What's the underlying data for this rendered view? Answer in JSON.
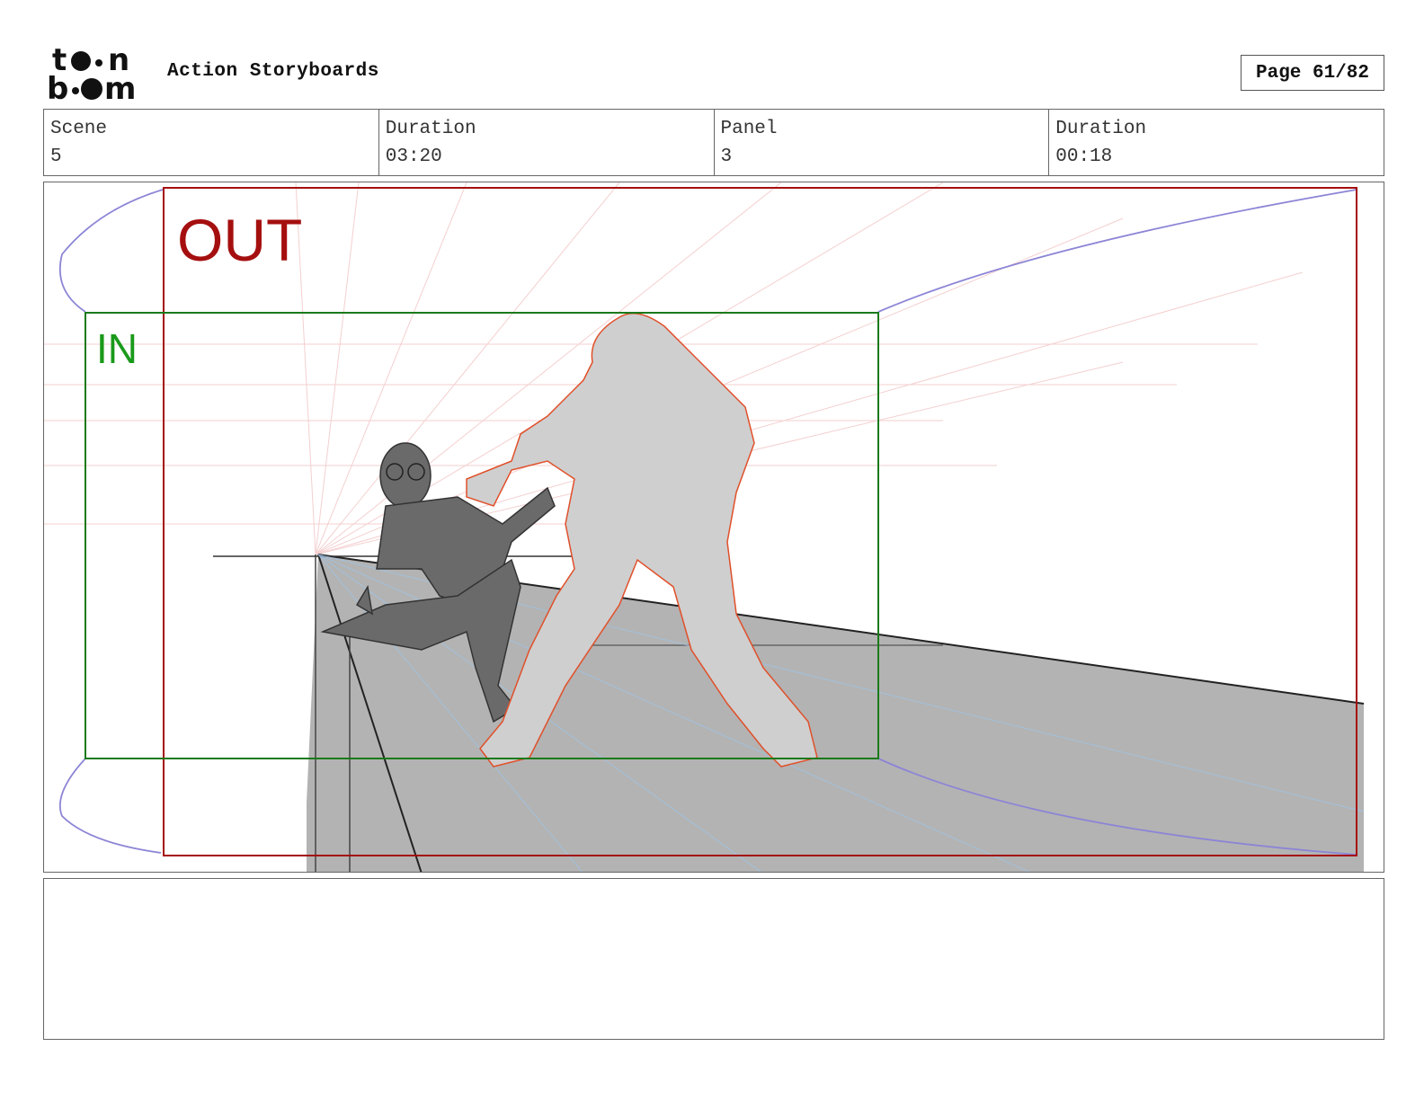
{
  "header": {
    "logo_text": "toon boom",
    "title": "Action Storyboards",
    "page_label": "Page 61/82"
  },
  "info": [
    {
      "label": "Scene",
      "value": "5"
    },
    {
      "label": "Duration",
      "value": "03:20"
    },
    {
      "label": "Panel",
      "value": "3"
    },
    {
      "label": "Duration",
      "value": "00:18"
    }
  ],
  "panel": {
    "out_label": "OUT",
    "in_label": "IN",
    "colors": {
      "out_frame": "#a50f0f",
      "in_frame": "#1a7a1a",
      "camera_arrow": "#8c85d6",
      "floor": "#b3b3b3",
      "hero": "#6a6a6a",
      "brute": "#cfcfcf",
      "brute_outline": "#e0502a"
    }
  },
  "notes": {
    "text": ""
  }
}
